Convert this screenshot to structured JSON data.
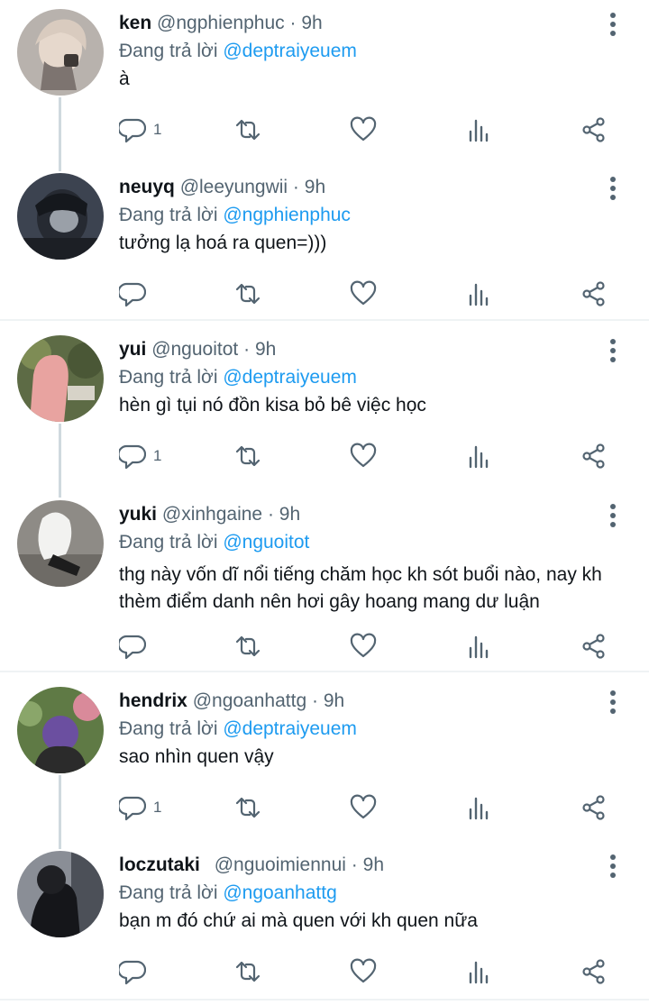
{
  "tweets": [
    {
      "name": "ken",
      "handle": "@ngphienphuc",
      "dot": "·",
      "time": "9h",
      "reply_prefix": "Đang trả lời",
      "reply_to": "@deptraiyeuem",
      "text": "à",
      "reply_count": "1"
    },
    {
      "name": "neuyq",
      "handle": "@leeyungwii",
      "dot": "·",
      "time": "9h",
      "reply_prefix": "Đang trả lời",
      "reply_to": "@ngphienphuc",
      "text": "tưởng lạ hoá ra quen=)))",
      "reply_count": ""
    },
    {
      "name": "yui",
      "handle": "@nguoitot",
      "dot": "·",
      "time": "9h",
      "reply_prefix": "Đang trả lời",
      "reply_to": "@deptraiyeuem",
      "text": "hèn gì tụi nó đồn kisa bỏ bê việc học",
      "reply_count": "1"
    },
    {
      "name": "yuki",
      "handle": "@xinhgaine",
      "dot": "·",
      "time": "9h",
      "reply_prefix": "Đang trả lời",
      "reply_to": "@nguoitot",
      "text": "thg này vốn dĩ nổi tiếng chăm học kh sót buổi nào, nay kh thèm điểm danh nên hơi gây hoang mang dư luận",
      "reply_count": ""
    },
    {
      "name": "hendrix",
      "handle": "@ngoanhattg",
      "dot": "·",
      "time": "9h",
      "reply_prefix": "Đang trả lời",
      "reply_to": "@deptraiyeuem",
      "text": "sao nhìn quen vậy",
      "reply_count": "1"
    },
    {
      "name": "loczutaki",
      "handle": "@nguoimiennui",
      "dot": "·",
      "time": "9h",
      "reply_prefix": "Đang trả lời",
      "reply_to": "@ngoanhattg",
      "text": "bạn m đó chứ ai mà quen với kh quen nữa",
      "reply_count": ""
    }
  ],
  "icons": {
    "reply": "reply-icon",
    "retweet": "retweet-icon",
    "like": "heart-icon",
    "views": "bar-chart-icon",
    "share": "share-icon",
    "more": "more-vertical-icon"
  },
  "colors": {
    "text": "#0f1419",
    "secondary": "#536471",
    "mention": "#1d9bf0",
    "divider": "#eff3f4",
    "thread_line": "#cfd9de"
  }
}
